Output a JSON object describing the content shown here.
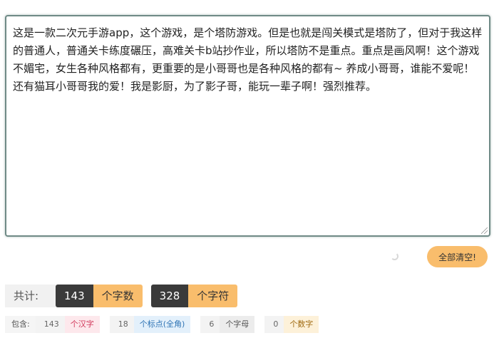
{
  "editor": {
    "text": "这是一款二次元手游app，这个游戏，是个塔防游戏。但是也就是闯关模式是塔防了，但对于我这样的普通人，普通关卡练度碾压，高难关卡b站抄作业，所以塔防不是重点。重点是画风啊！这个游戏不媚宅，女生各种风格都有，更重要的是小哥哥也是各种风格的都有~ 养成小哥哥，谁能不爱呢！还有猫耳小哥哥我的爱！我是影厨，为了影子哥，能玩一辈子啊！强烈推荐。"
  },
  "actions": {
    "clear_label": "全部清空!"
  },
  "totals": {
    "label": "共计:",
    "word_count": "143",
    "word_unit": "个字数",
    "char_count": "328",
    "char_unit": "个字符"
  },
  "details": {
    "label": "包含:",
    "items": [
      {
        "count": "143",
        "unit": "个汉字"
      },
      {
        "count": "18",
        "unit": "个标点(全角)"
      },
      {
        "count": "6",
        "unit": "个字母"
      },
      {
        "count": "0",
        "unit": "个数字"
      }
    ]
  },
  "colors": {
    "accent": "#f9bd6c",
    "dark": "#3a3a3a",
    "border": "#6f8a86"
  }
}
